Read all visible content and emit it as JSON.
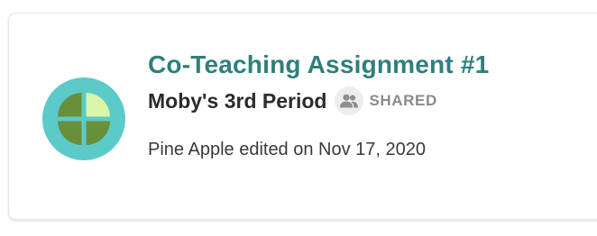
{
  "card": {
    "title": "Co-Teaching Assignment #1",
    "class_name": "Moby's 3rd Period",
    "shared_label": "SHARED",
    "shared_icon": "people-icon",
    "edited_text": "Pine Apple edited on Nov 17, 2020",
    "avatar_icon": "quadrant-pie-icon"
  },
  "colors": {
    "title": "#2f7f7d",
    "avatar_background": "#5ccac9",
    "avatar_quadrants": "#6a8f3a",
    "avatar_highlight_quadrant": "#d9f7a6",
    "shared_icon": "#8e8e8e"
  }
}
